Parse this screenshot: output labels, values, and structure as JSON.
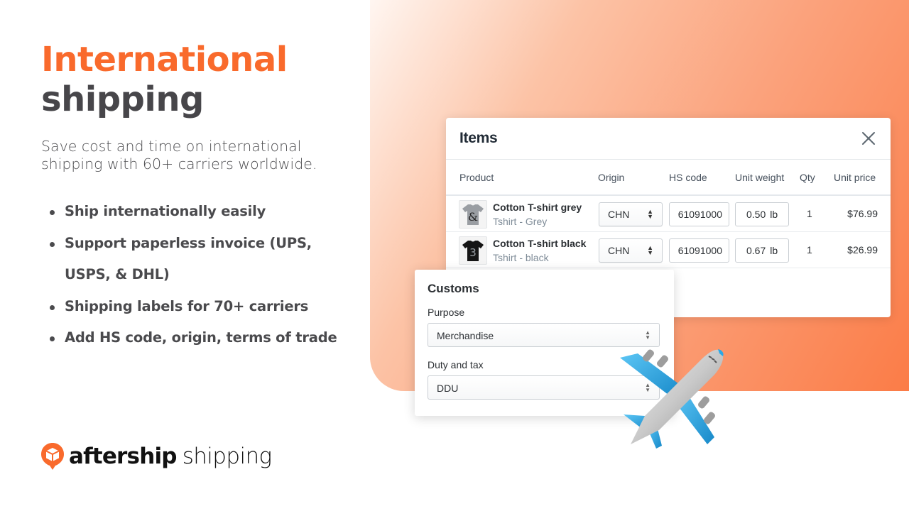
{
  "colors": {
    "accent": "#f96a2c",
    "heading_dark": "#47464a",
    "plane_blue": "#2aa8e6"
  },
  "hero": {
    "title_line1": "International",
    "title_line2": "shipping",
    "subtitle": "Save cost and time on international shipping with 60+ carriers worldwide.",
    "features": [
      "Ship internationally easily",
      "Support paperless invoice (UPS, USPS, & DHL)",
      "Shipping labels for 70+ carriers",
      "Add HS code, origin, terms of trade"
    ]
  },
  "logo": {
    "brand": "aftership",
    "product": "shipping",
    "icon": "aftership-box-pin-icon"
  },
  "items_modal": {
    "title": "Items",
    "close_icon": "close-icon",
    "columns": [
      "Product",
      "Origin",
      "HS code",
      "Unit weight",
      "Qty",
      "Unit price"
    ],
    "rows": [
      {
        "name": "Cotton T-shirt grey",
        "variant": "Tshirt - Grey",
        "thumb_glyph": "&",
        "origin": "CHN",
        "hs_code": "61091000",
        "weight": "0.50",
        "unit": "lb",
        "qty": "1",
        "price": "$76.99"
      },
      {
        "name": "Cotton T-shirt black",
        "variant": "Tshirt - black",
        "thumb_glyph": "3",
        "origin": "CHN",
        "hs_code": "61091000",
        "weight": "0.67",
        "unit": "lb",
        "qty": "1",
        "price": "$26.99"
      }
    ]
  },
  "customs": {
    "title": "Customs",
    "purpose_label": "Purpose",
    "purpose_value": "Merchandise",
    "duty_label": "Duty and tax",
    "duty_value": "DDU"
  },
  "decoration": {
    "emoji": "airplane-icon"
  }
}
